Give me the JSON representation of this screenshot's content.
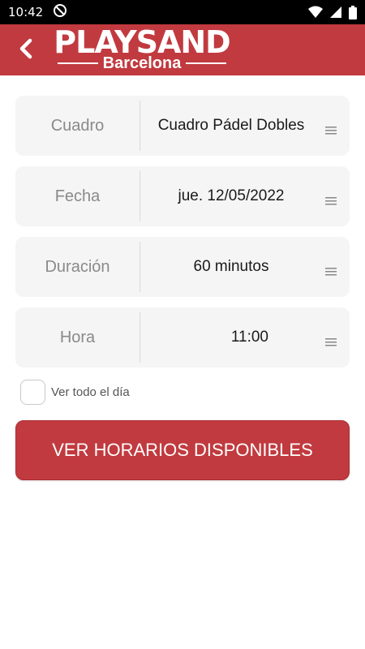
{
  "status_bar": {
    "time": "10:42",
    "icons": [
      "do-not-disturb-icon",
      "wifi-icon",
      "cellular-signal-icon",
      "battery-icon"
    ]
  },
  "header": {
    "background_color": "#c13a3f",
    "back_icon": "chevron-left-icon",
    "logo_main": "PLAYSAND",
    "logo_sub": "Barcelona"
  },
  "form": {
    "fields": [
      {
        "label": "Cuadro",
        "value": "Cuadro Pádel Dobles",
        "icon": "menu-icon"
      },
      {
        "label": "Fecha",
        "value": "jue. 12/05/2022",
        "icon": "menu-icon"
      },
      {
        "label": "Duración",
        "value": "60 minutos",
        "icon": "menu-icon"
      },
      {
        "label": "Hora",
        "value": "11:00",
        "icon": "menu-icon"
      }
    ]
  },
  "all_day_checkbox": {
    "label": "Ver todo el día",
    "checked": false
  },
  "cta_button": {
    "label": "VER HORARIOS DISPONIBLES",
    "color": "#c13a3f"
  }
}
